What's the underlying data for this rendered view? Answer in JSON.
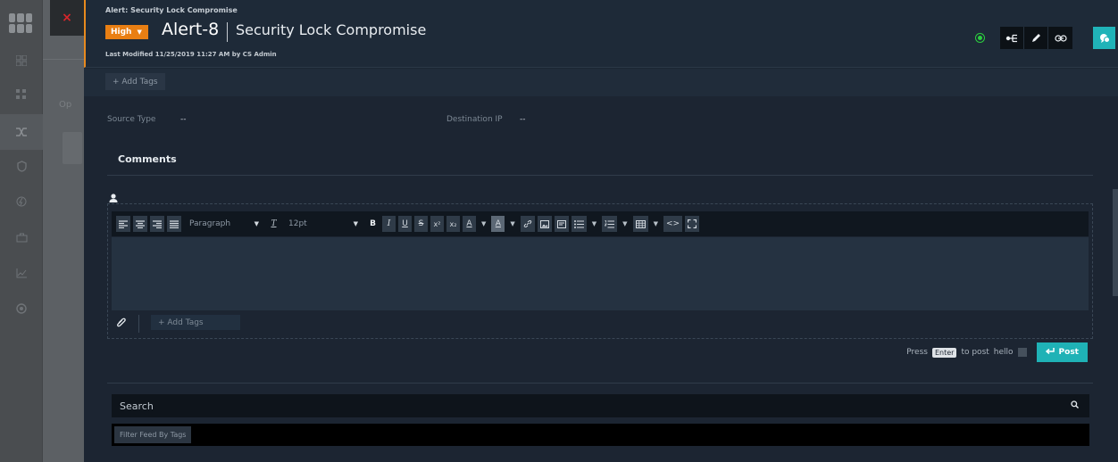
{
  "header": {
    "breadcrumb": "Alert: Security Lock Compromise",
    "severity": "High",
    "alert_id": "Alert-8",
    "alert_title": "Security Lock Compromise",
    "last_modified": "Last Modified 11/25/2019 11:27 AM by CS Admin",
    "status_color": "#2bcf3f",
    "icons": [
      "relations-icon",
      "edit-pencil-icon",
      "link-icon",
      "collaboration-chat-icon"
    ]
  },
  "tags": {
    "add_label": "+ Add Tags"
  },
  "fields": [
    {
      "label": "Source Type",
      "value": "--"
    },
    {
      "label": "Destination IP",
      "value": "--"
    }
  ],
  "comments": {
    "heading": "Comments",
    "toolbar": {
      "format_select": "Paragraph",
      "font_size_select": "12pt",
      "bold": "B",
      "italic": "I",
      "underline": "U",
      "strike": "S",
      "superscript": "x²",
      "subscript": "x₂",
      "text_color": "A",
      "bg_color": "A"
    },
    "add_tags_label": "+ Add Tags",
    "press": "Press",
    "enter_key": "Enter",
    "to_post": "to post",
    "hello": "hello",
    "post_label": "Post"
  },
  "feed": {
    "search_placeholder": "Search",
    "filter_label": "Filter Feed By Tags"
  },
  "background": {
    "tab_text": "Op"
  },
  "colors": {
    "accent": "#20b3b8",
    "severity_high": "#e97f13",
    "header_bg": "#1e2a38"
  }
}
